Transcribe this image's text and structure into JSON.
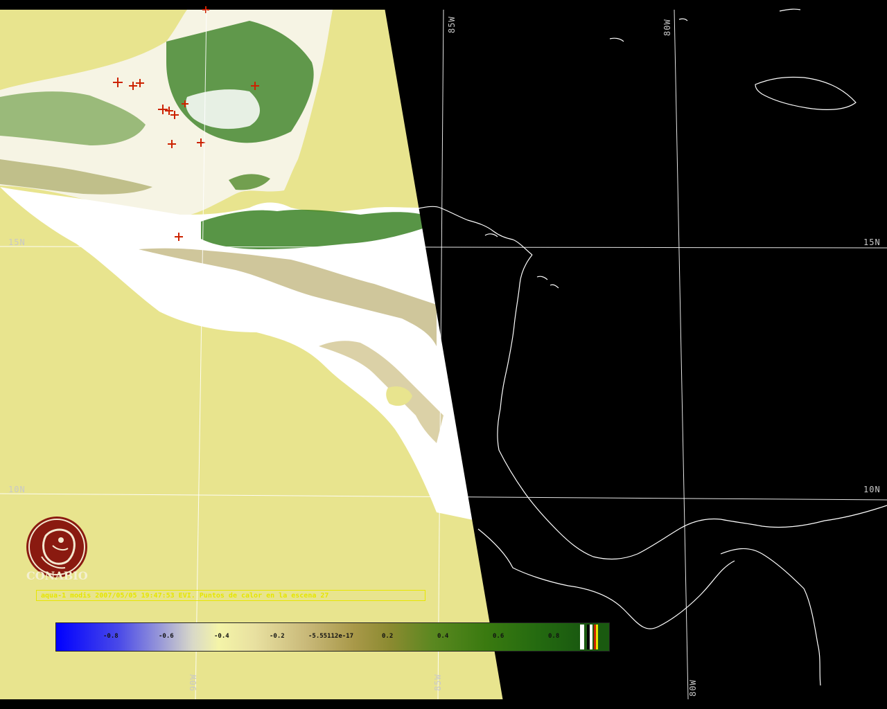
{
  "grid_labels": {
    "lat_15N_left": "15N",
    "lat_15N_right": "15N",
    "lat_10N_left": "10N",
    "lat_10N_right": "10N",
    "lon_85W_top": "85W",
    "lon_80W_top": "80W",
    "lon_90W_bottom": "90W",
    "lon_85W_bottom": "85W",
    "lon_80W_bottom": "80W"
  },
  "logo": {
    "name": "CONABIO"
  },
  "caption": "aqua-1 modis 2007/05/05 19:47:53 EVI. Puntos de calor en la escena 27",
  "legend": {
    "ticks": [
      "-0.8",
      "-0.6",
      "-0.4",
      "-0.2",
      "-5.55112e-17",
      "0.2",
      "0.4",
      "0.6",
      "0.8"
    ]
  },
  "colors": {
    "ocean_fill": "#e8e48e",
    "cloud_white": "#ffffff",
    "vegetation_green": "#2e7a18",
    "hotspot_red": "#cc2200",
    "no_data_black": "#000000",
    "coastline_white": "#ffffff",
    "caption_yellow": "#e6e600",
    "logo_maroon": "#8a1a10"
  }
}
